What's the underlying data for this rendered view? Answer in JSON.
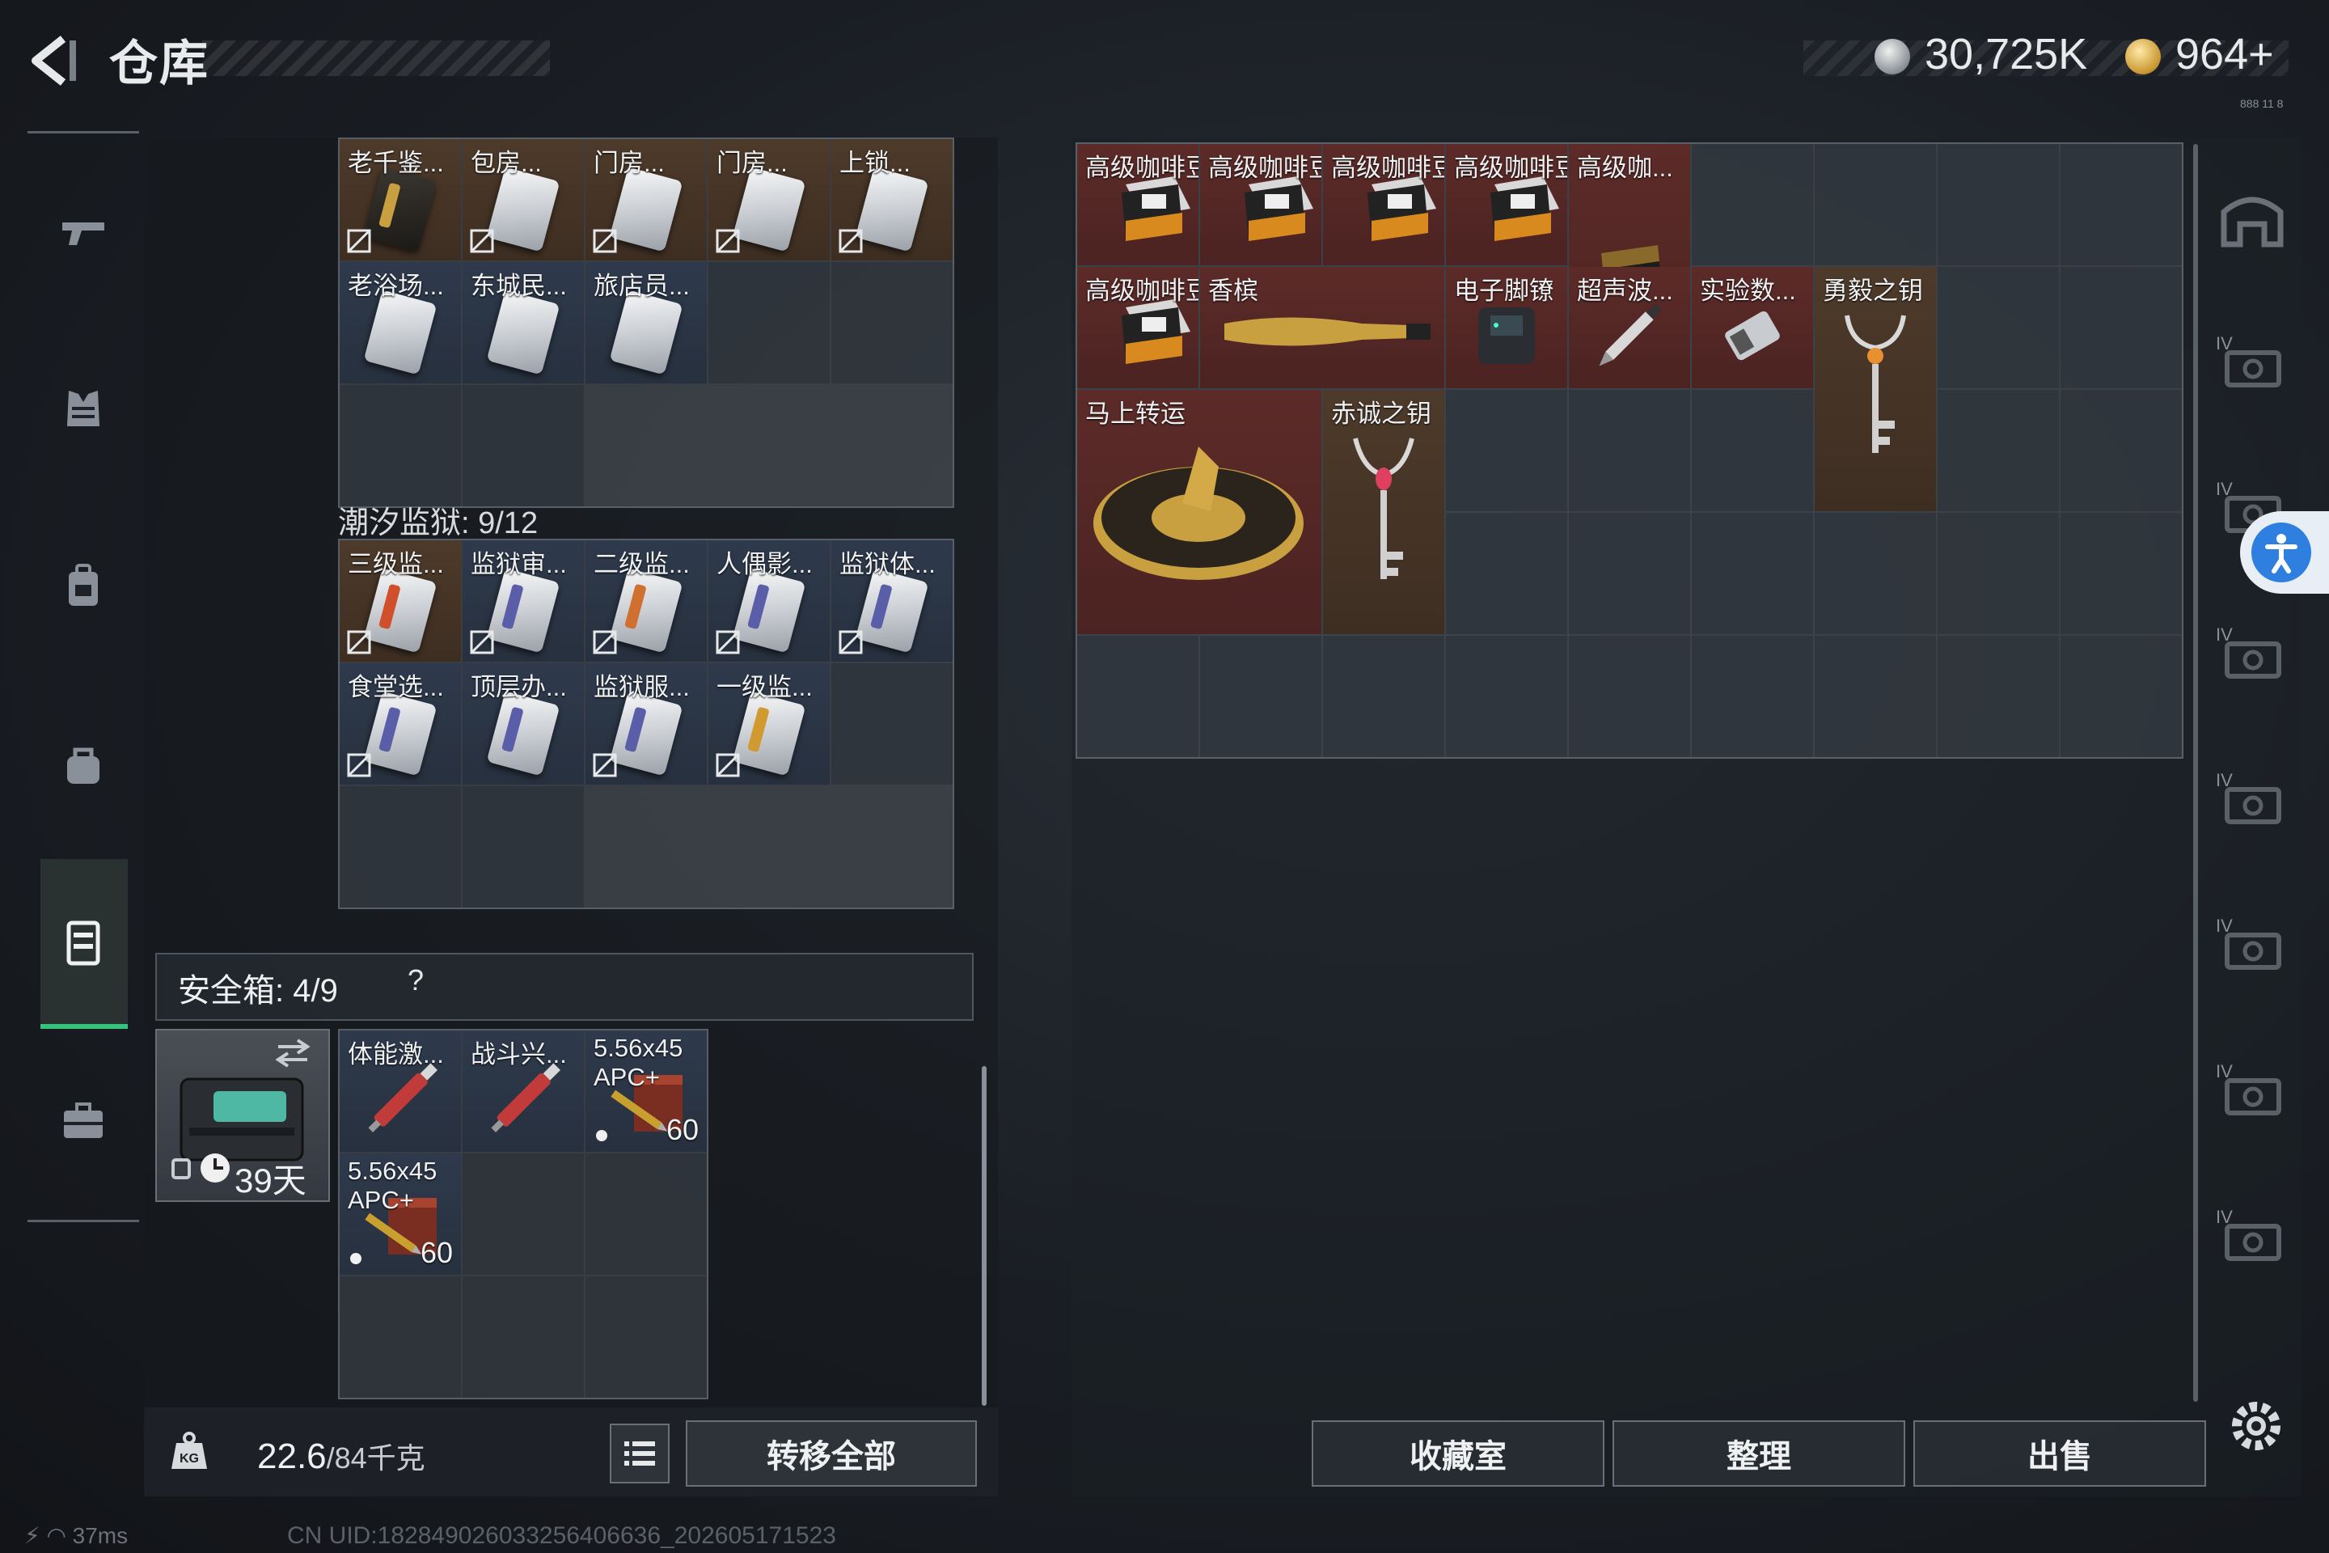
{
  "header": {
    "title": "仓库",
    "currency_silver": "30,725K",
    "currency_gold": "964+",
    "tiny_text": "888 11 8"
  },
  "nav": {
    "items": [
      "gun-icon",
      "armor-icon",
      "backpack-icon",
      "bag-icon",
      "storage-icon",
      "briefcase-icon"
    ]
  },
  "top_grid": {
    "rows": [
      [
        {
          "name": "老千鉴...",
          "style": "gold",
          "icon": "card-dark",
          "no_trade": true
        },
        {
          "name": "包房...",
          "style": "gold",
          "icon": "card",
          "no_trade": true
        },
        {
          "name": "门房...",
          "style": "gold",
          "icon": "card",
          "no_trade": true
        },
        {
          "name": "门房...",
          "style": "gold",
          "icon": "card",
          "no_trade": true
        },
        {
          "name": "上锁...",
          "style": "gold",
          "icon": "card",
          "no_trade": true
        }
      ],
      [
        {
          "name": "老浴场...",
          "style": "blue",
          "icon": "card"
        },
        {
          "name": "东城民...",
          "style": "blue",
          "icon": "card"
        },
        {
          "name": "旅店员...",
          "style": "blue",
          "icon": "card"
        },
        {
          "name": "",
          "style": "empty"
        },
        {
          "name": "",
          "style": "empty"
        }
      ],
      [
        {
          "name": "",
          "style": "empty"
        },
        {
          "name": "",
          "style": "empty"
        }
      ]
    ]
  },
  "section_prison": {
    "title": "潮汐监狱: 9/12",
    "rows": [
      [
        {
          "name": "三级监...",
          "style": "gold",
          "icon": "card",
          "stripe": "#d0502c",
          "no_trade": true
        },
        {
          "name": "监狱审...",
          "style": "blue",
          "icon": "card",
          "stripe": "#5a5ea8",
          "no_trade": true
        },
        {
          "name": "二级监...",
          "style": "blue",
          "icon": "card",
          "stripe": "#d07030",
          "no_trade": true
        },
        {
          "name": "人偶影...",
          "style": "blue",
          "icon": "card",
          "stripe": "#5a5ea8",
          "no_trade": true
        },
        {
          "name": "监狱体...",
          "style": "blue",
          "icon": "card",
          "stripe": "#5a5ea8",
          "no_trade": true
        }
      ],
      [
        {
          "name": "食堂选...",
          "style": "blue",
          "icon": "card",
          "stripe": "#5a5ea8",
          "no_trade": true
        },
        {
          "name": "顶层办...",
          "style": "blue",
          "icon": "card",
          "stripe": "#5a5ea8"
        },
        {
          "name": "监狱服...",
          "style": "blue",
          "icon": "card",
          "stripe": "#5a5ea8",
          "no_trade": true
        },
        {
          "name": "一级监...",
          "style": "blue",
          "icon": "card",
          "stripe": "#d09a30",
          "no_trade": true
        },
        {
          "name": "",
          "style": "empty"
        }
      ],
      [
        {
          "name": "",
          "style": "empty"
        },
        {
          "name": "",
          "style": "empty"
        }
      ]
    ]
  },
  "safe_box": {
    "label": "安全箱: 4/9",
    "help": "?",
    "days": "39天",
    "items": [
      {
        "name": "体能激...",
        "style": "blue",
        "icon": "injector"
      },
      {
        "name": "战斗兴...",
        "style": "blue",
        "icon": "injector"
      },
      {
        "name": "5.56x45\nAPC+",
        "style": "blue",
        "icon": "ammo",
        "count": "60"
      },
      {
        "name": "5.56x45\nAPC+",
        "style": "blue",
        "icon": "ammo",
        "count": "60"
      },
      {
        "name": "",
        "style": "empty"
      },
      {
        "name": "",
        "style": "empty"
      },
      {
        "name": "",
        "style": "empty"
      },
      {
        "name": "",
        "style": "empty"
      },
      {
        "name": "",
        "style": "empty"
      }
    ]
  },
  "right_grid": {
    "items": [
      {
        "name": "高级咖啡豆",
        "style": "red",
        "icon": "coffee"
      },
      {
        "name": "高级咖啡豆",
        "style": "red",
        "icon": "coffee"
      },
      {
        "name": "高级咖啡豆",
        "style": "red",
        "icon": "coffee"
      },
      {
        "name": "高级咖啡豆",
        "style": "red",
        "icon": "coffee"
      },
      {
        "name": "高级咖...",
        "style": "red",
        "icon": "coffee-bag"
      },
      {
        "name": "高级咖啡豆",
        "style": "red",
        "icon": "coffee"
      },
      {
        "name": "香槟",
        "style": "red",
        "icon": "champagne"
      },
      {
        "name": "电子脚镣",
        "style": "red",
        "icon": "anklet"
      },
      {
        "name": "超声波...",
        "style": "red",
        "icon": "probe"
      },
      {
        "name": "实验数...",
        "style": "red",
        "icon": "drive"
      },
      {
        "name": "勇毅之钥",
        "style": "red",
        "icon": "key-horn"
      },
      {
        "name": "马上转运",
        "style": "red",
        "icon": "horse-coin"
      },
      {
        "name": "赤诚之钥",
        "style": "red",
        "icon": "key-ruby"
      }
    ]
  },
  "bottom": {
    "weight": "22.6",
    "weight_max": "/84千克",
    "transfer_all": "转移全部",
    "collection": "收藏室",
    "organize": "整理",
    "sell": "出售"
  },
  "status": {
    "ping": "37ms",
    "uid": "CN UID:182849026033256406636_202605171523"
  },
  "colors": {
    "accent_green": "#35c47c",
    "item_red": "#5c2b28",
    "access_blue": "#2f7fe0"
  }
}
